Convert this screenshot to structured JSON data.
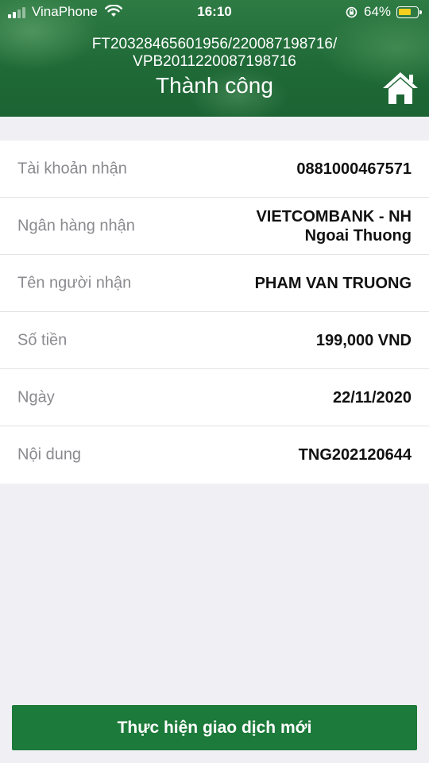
{
  "status_bar": {
    "carrier": "VinaPhone",
    "time": "16:10",
    "battery": "64%"
  },
  "header": {
    "reference_line1": "FT20328465601956/220087198716/",
    "reference_line2": "VPB2011220087198716",
    "title": "Thành công",
    "home_icon": "home-icon"
  },
  "details": [
    {
      "label": "Tài khoản nhận",
      "value": "0881000467571"
    },
    {
      "label": "Ngân hàng nhận",
      "value_line1": "VIETCOMBANK - NH",
      "value_line2": "Ngoai Thuong"
    },
    {
      "label": "Tên người nhận",
      "value": "PHAM VAN TRUONG"
    },
    {
      "label": "Số tiền",
      "value": "199,000 VND"
    },
    {
      "label": "Ngày",
      "value": "22/11/2020"
    },
    {
      "label": "Nội dung",
      "value": "TNG202120644"
    }
  ],
  "actions": {
    "new_transaction": "Thực hiện giao dịch mới"
  },
  "colors": {
    "header_green": "#1f6a37",
    "button_green": "#1c7a3a",
    "battery_yellow": "#f4cf1e"
  }
}
